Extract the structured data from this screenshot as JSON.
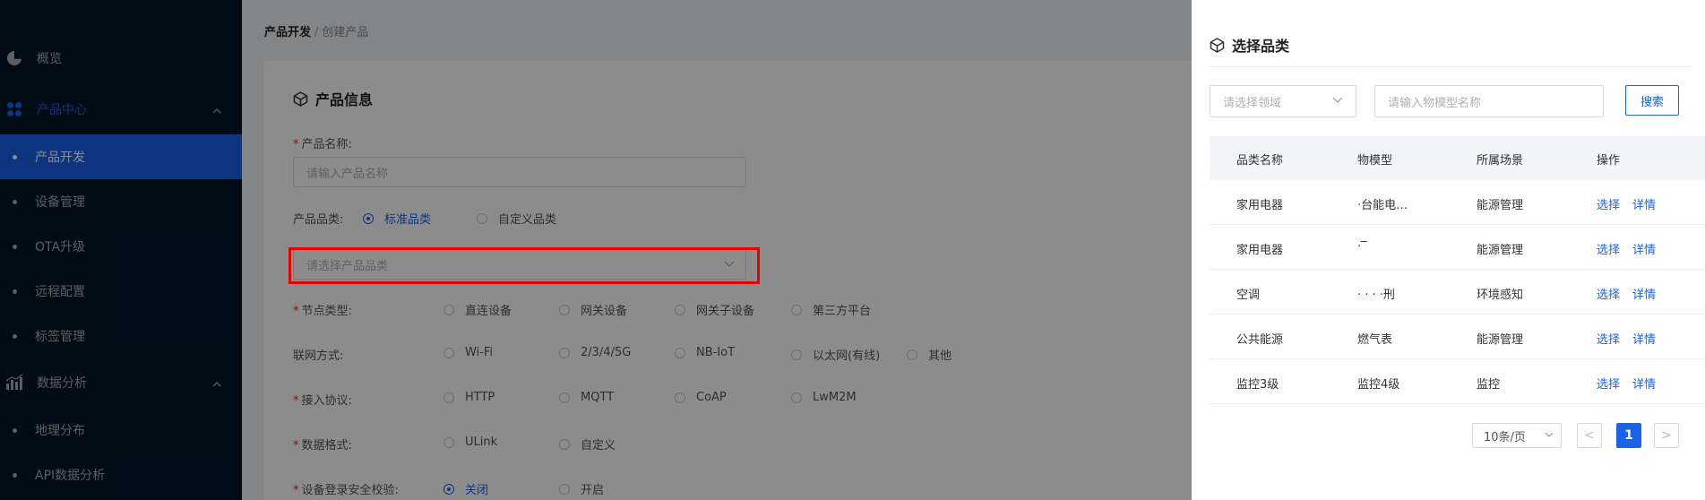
{
  "sidebar": {
    "items": [
      {
        "label": "概览",
        "icon": "pie-chart-icon"
      },
      {
        "label": "产品中心",
        "icon": "grid-icon"
      },
      {
        "label": "产品开发"
      },
      {
        "label": "设备管理"
      },
      {
        "label": "OTA升级"
      },
      {
        "label": "远程配置"
      },
      {
        "label": "标签管理"
      },
      {
        "label": "数据分析",
        "icon": "bar-chart-icon"
      },
      {
        "label": "地理分布"
      },
      {
        "label": "API数据分析"
      }
    ]
  },
  "breadcrumb": {
    "root": "产品开发",
    "separator": "/",
    "current": "创建产品"
  },
  "form": {
    "section_title": "产品信息",
    "product_name_label": "产品名称:",
    "product_name_placeholder": "请输入产品名称",
    "category_label": "产品品类:",
    "category_options": [
      "标准品类",
      "自定义品类"
    ],
    "category_select_placeholder": "请选择产品品类",
    "node_type_label": "节点类型:",
    "node_type_options": [
      "直连设备",
      "网关设备",
      "网关子设备",
      "第三方平台"
    ],
    "network_label": "联网方式:",
    "network_options": [
      "Wi-Fi",
      "2/3/4/5G",
      "NB-IoT",
      "以太网(有线)",
      "其他"
    ],
    "protocol_label": "接入协议:",
    "protocol_options": [
      "HTTP",
      "MQTT",
      "CoAP",
      "LwM2M"
    ],
    "data_format_label": "数据格式:",
    "data_format_options": [
      "ULink",
      "自定义"
    ],
    "security_label": "设备登录安全校验:",
    "security_options": [
      "关闭",
      "开启"
    ],
    "required_mark": "*"
  },
  "drawer": {
    "title": "选择品类",
    "domain_placeholder": "请选择领域",
    "model_placeholder": "请输入物模型名称",
    "search_label": "搜索",
    "columns": [
      "品类名称",
      "物模型",
      "所属场景",
      "操作"
    ],
    "rows": [
      {
        "category": "家用电器",
        "model": "·台能电…",
        "scene": "能源管理"
      },
      {
        "category": "家用电器",
        "model": "·‾",
        "scene": "能源管理"
      },
      {
        "category": "空调",
        "model": "·     ·  ·  ·刑",
        "scene": "环境感知"
      },
      {
        "category": "公共能源",
        "model": "燃气表",
        "scene": "能源管理"
      },
      {
        "category": "监控3级",
        "model": "监控4级",
        "scene": "监控"
      }
    ],
    "action_select": "选择",
    "action_detail": "详情",
    "page_size": "10条/页",
    "current_page": "1",
    "prev": "<",
    "next": ">"
  }
}
